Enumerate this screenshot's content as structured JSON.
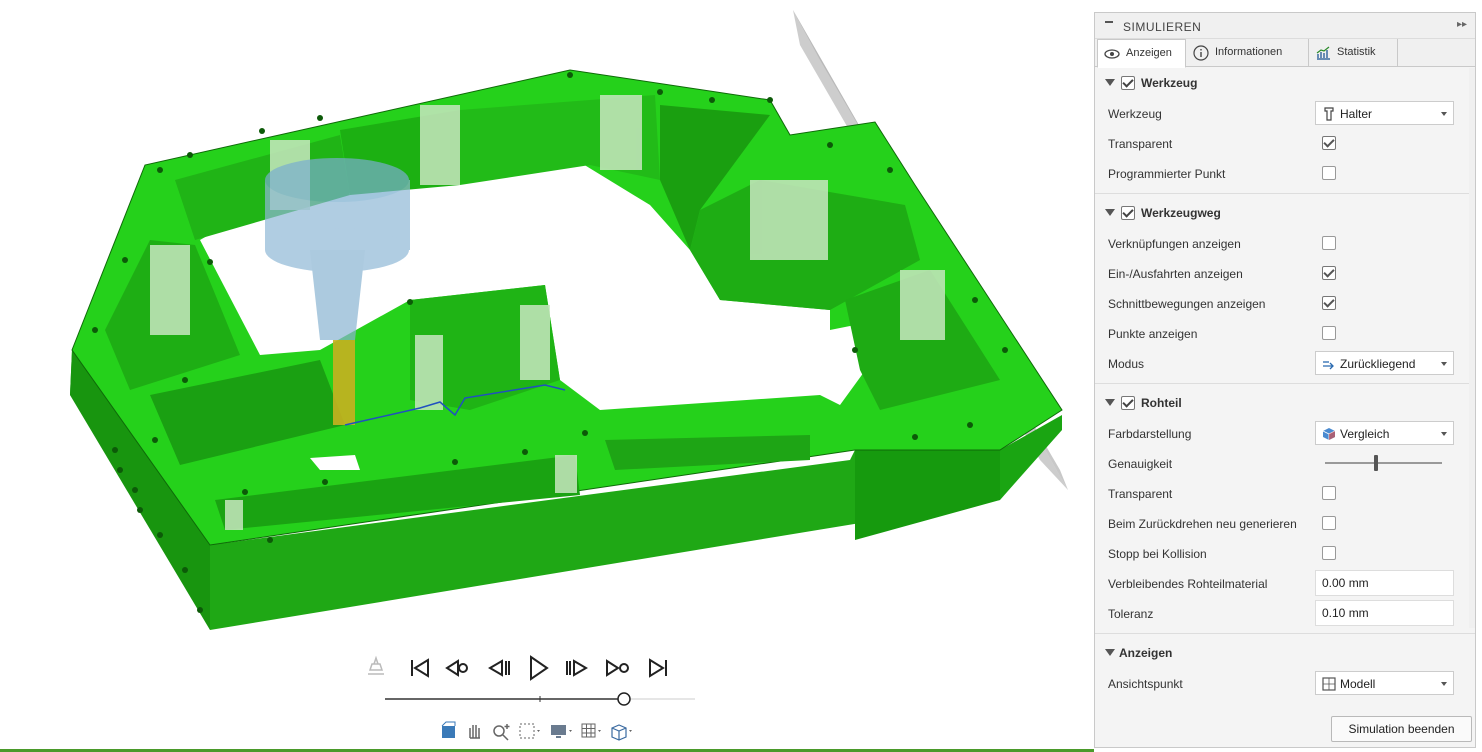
{
  "panel": {
    "title": "SIMULIEREN",
    "tabs": [
      {
        "label": "Anzeigen",
        "icon": "eye-icon"
      },
      {
        "label": "Informationen",
        "icon": "info-icon"
      },
      {
        "label": "Statistik",
        "icon": "chart-icon"
      }
    ],
    "sections": {
      "werkzeug": {
        "title": "Werkzeug",
        "checked": true,
        "werkzeug_label": "Werkzeug",
        "werkzeug_value": "Halter",
        "transparent_label": "Transparent",
        "transparent_checked": true,
        "programmed_point_label": "Programmierter Punkt",
        "programmed_point_checked": false
      },
      "werkzeugweg": {
        "title": "Werkzeugweg",
        "checked": true,
        "links_label": "Verknüpfungen anzeigen",
        "links_checked": false,
        "entry_exit_label": "Ein-/Ausfahrten anzeigen",
        "entry_exit_checked": true,
        "cut_moves_label": "Schnittbewegungen anzeigen",
        "cut_moves_checked": true,
        "points_label": "Punkte anzeigen",
        "points_checked": false,
        "mode_label": "Modus",
        "mode_value": "Zurückliegend"
      },
      "rohteil": {
        "title": "Rohteil",
        "checked": true,
        "color_label": "Farbdarstellung",
        "color_value": "Vergleich",
        "accuracy_label": "Genauigkeit",
        "accuracy_level": 0.42,
        "transparent_label": "Transparent",
        "transparent_checked": false,
        "regen_label": "Beim Zurückdrehen neu generieren",
        "regen_checked": false,
        "stop_label": "Stopp bei Kollision",
        "stop_checked": false,
        "remaining_label": "Verbleibendes Rohteilmaterial",
        "remaining_value": "0.00 mm",
        "tolerance_label": "Toleranz",
        "tolerance_value": "0.10 mm"
      },
      "anzeigen": {
        "title": "Anzeigen",
        "viewpoint_label": "Ansichtspunkt",
        "viewpoint_value": "Modell"
      }
    },
    "finish_button": "Simulation beenden"
  },
  "playback": {
    "buttons": [
      "skip-to-start",
      "previous-operation",
      "step-back",
      "play",
      "step-forward",
      "next-operation",
      "skip-to-end"
    ],
    "progress": 0.77
  },
  "colors": {
    "part_green": "#22d41a",
    "panel_bg": "#f4f4f4",
    "tool_holder": "#8fb8d6",
    "tool_tip": "#c8b020",
    "toolpath": "#2050c0"
  }
}
